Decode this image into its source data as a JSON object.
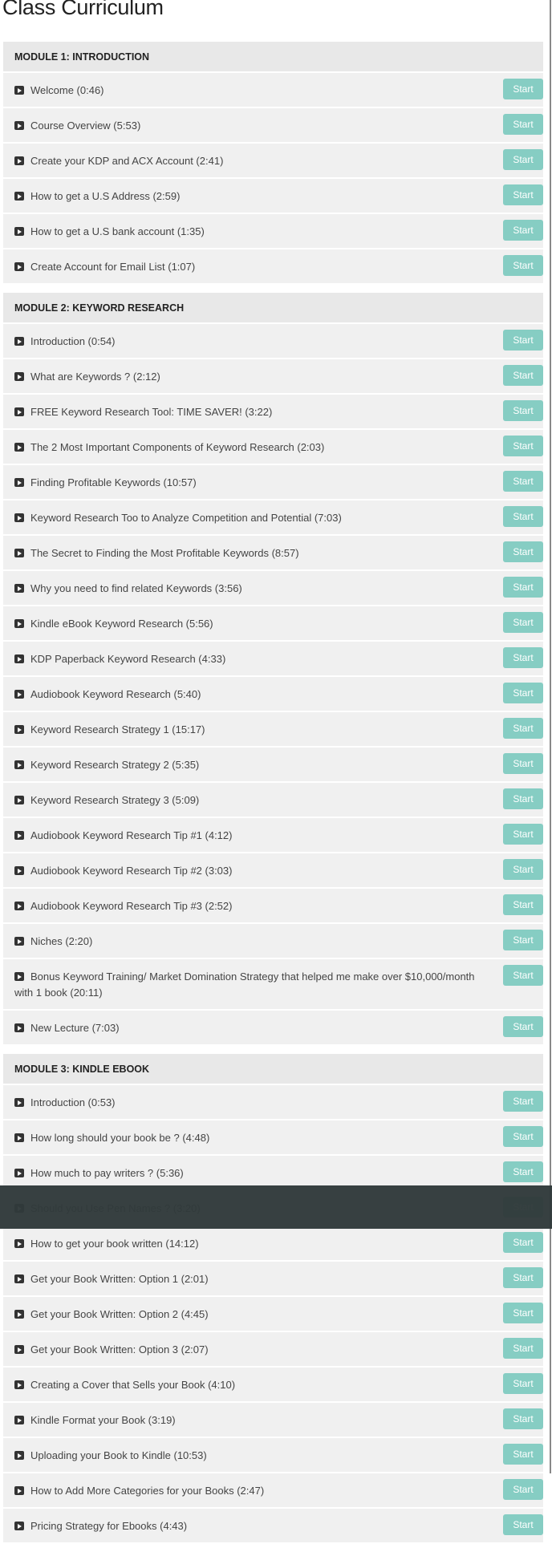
{
  "page_title": "Class Curriculum",
  "start_label": "Start",
  "colors": {
    "button": "#86cdc3",
    "row_bg": "#f0f0f0",
    "header_bg": "#e8e8e8",
    "overlay": "#313a3b"
  },
  "modules": [
    {
      "title": "MODULE 1: INTRODUCTION",
      "lectures": [
        "Welcome (0:46)",
        "Course Overview (5:53)",
        "Create your KDP and ACX Account (2:41)",
        "How to get a U.S Address (2:59)",
        "How to get a U.S bank account (1:35)",
        "Create Account for Email List (1:07)"
      ]
    },
    {
      "title": "MODULE 2: KEYWORD RESEARCH",
      "lectures": [
        "Introduction (0:54)",
        "What are Keywords ? (2:12)",
        "FREE Keyword Research Tool: TIME SAVER! (3:22)",
        "The 2 Most Important Components of Keyword Research (2:03)",
        "Finding Profitable Keywords (10:57)",
        "Keyword Research Too to Analyze Competition and Potential (7:03)",
        "The Secret to Finding the Most Profitable Keywords (8:57)",
        "Why you need to find related Keywords (3:56)",
        "Kindle eBook Keyword Research (5:56)",
        "KDP Paperback Keyword Research (4:33)",
        "Audiobook Keyword Research (5:40)",
        "Keyword Research Strategy 1 (15:17)",
        "Keyword Research Strategy 2 (5:35)",
        "Keyword Research Strategy 3 (5:09)",
        "Audiobook Keyword Research Tip #1 (4:12)",
        "Audiobook Keyword Research Tip #2 (3:03)",
        "Audiobook Keyword Research Tip #3 (2:52)",
        "Niches (2:20)",
        "Bonus Keyword Training/ Market Domination Strategy that helped me make over $10,000/month with 1 book (20:11)",
        "New Lecture (7:03)"
      ]
    },
    {
      "title": "MODULE 3: KINDLE EBOOK",
      "lectures": [
        "Introduction (0:53)",
        "How long should your book be ? (4:48)",
        "How much to pay writers ? (5:36)",
        "Should you Use Pen Names ? (3:20)",
        "How to get your book written (14:12)",
        "Get your Book Written: Option 1 (2:01)",
        "Get your Book Written: Option 2 (4:45)",
        "Get your Book Written: Option 3 (2:07)",
        "Creating a Cover that Sells your Book (4:10)",
        "Kindle Format your Book (3:19)",
        "Uploading your Book to Kindle (10:53)",
        "How to Add More Categories for your Books (2:47)",
        "Pricing Strategy for Ebooks (4:43)"
      ]
    }
  ]
}
